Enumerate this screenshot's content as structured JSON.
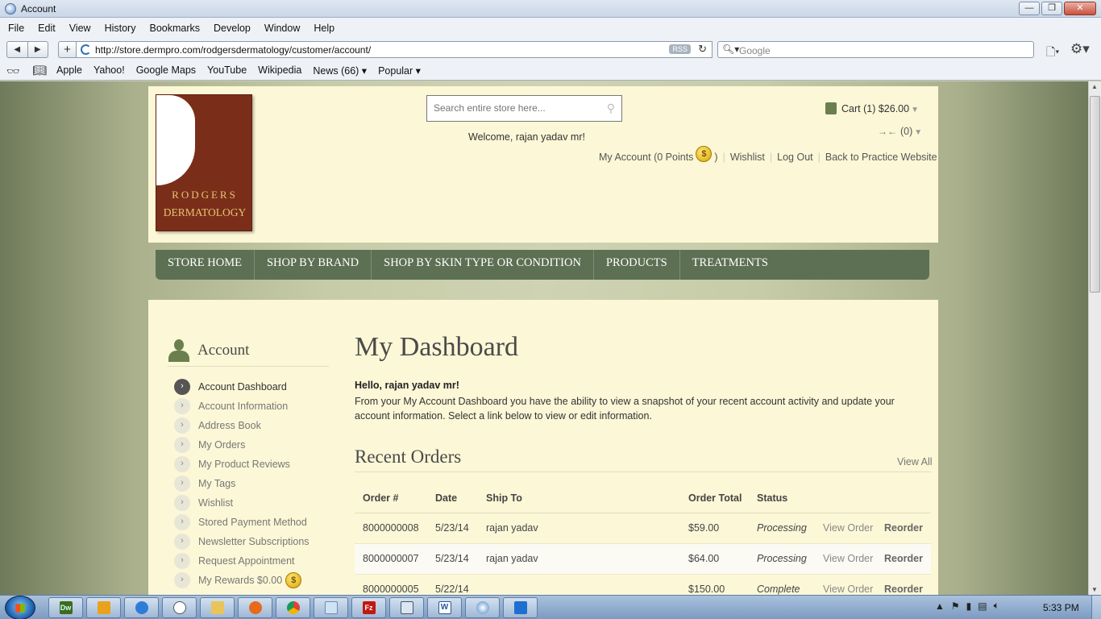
{
  "window": {
    "title": "Account"
  },
  "menu": [
    "File",
    "Edit",
    "View",
    "History",
    "Bookmarks",
    "Develop",
    "Window",
    "Help"
  ],
  "toolbar": {
    "url": "http://store.dermpro.com/rodgersdermatology/customer/account/",
    "rss": "RSS",
    "search_placeholder": "Google"
  },
  "bookmarks": [
    "Apple",
    "Yahoo!",
    "Google Maps",
    "YouTube",
    "Wikipedia",
    "News (66) ▾",
    "Popular ▾"
  ],
  "header": {
    "logo_line1": "RODGERS",
    "logo_line2": "DERMATOLOGY",
    "search_placeholder": "Search entire store here...",
    "welcome": "Welcome, rajan yadav mr!",
    "cart": "Cart (1)  $26.00",
    "compare": "(0)",
    "my_account": "My Account (0 Points",
    "my_account_close": ")",
    "wishlist": "Wishlist",
    "logout": "Log Out",
    "back": "Back to Practice Website"
  },
  "nav": [
    "STORE HOME",
    "SHOP BY BRAND",
    "SHOP BY SKIN TYPE OR CONDITION",
    "PRODUCTS",
    "TREATMENTS"
  ],
  "sidebar": {
    "title": "Account",
    "items": [
      "Account Dashboard",
      "Account Information",
      "Address Book",
      "My Orders",
      "My Product Reviews",
      "My Tags",
      "Wishlist",
      "Stored Payment Method",
      "Newsletter Subscriptions",
      "Request Appointment",
      "My Rewards $0.00"
    ]
  },
  "main": {
    "title": "My Dashboard",
    "hello": "Hello, rajan yadav mr!",
    "intro": "From your My Account Dashboard you have the ability to view a snapshot of your recent account activity and update your account information. Select a link below to view or edit information.",
    "recent_title": "Recent Orders",
    "view_all": "View All",
    "columns": [
      "Order #",
      "Date",
      "Ship To",
      "Order Total",
      "Status"
    ],
    "orders": [
      {
        "id": "8000000008",
        "date": "5/23/14",
        "ship_to": "rajan yadav",
        "total": "$59.00",
        "status": "Processing",
        "view": "View Order",
        "reorder": "Reorder"
      },
      {
        "id": "8000000007",
        "date": "5/23/14",
        "ship_to": "rajan yadav",
        "total": "$64.00",
        "status": "Processing",
        "view": "View Order",
        "reorder": "Reorder"
      },
      {
        "id": "8000000005",
        "date": "5/22/14",
        "ship_to": "",
        "total": "$150.00",
        "status": "Complete",
        "view": "View Order",
        "reorder": "Reorder"
      }
    ]
  },
  "taskbar": {
    "apps": [
      "Dw",
      "",
      "",
      "",
      "",
      "",
      "",
      "",
      "Fz",
      "",
      "W",
      "",
      ""
    ],
    "clock": "5:33 PM"
  },
  "colors": {
    "nav_green": "#5d7053",
    "header_cream": "#fcf7d6",
    "logo_brown": "#7a2e1a"
  },
  "coin_symbol": "$"
}
